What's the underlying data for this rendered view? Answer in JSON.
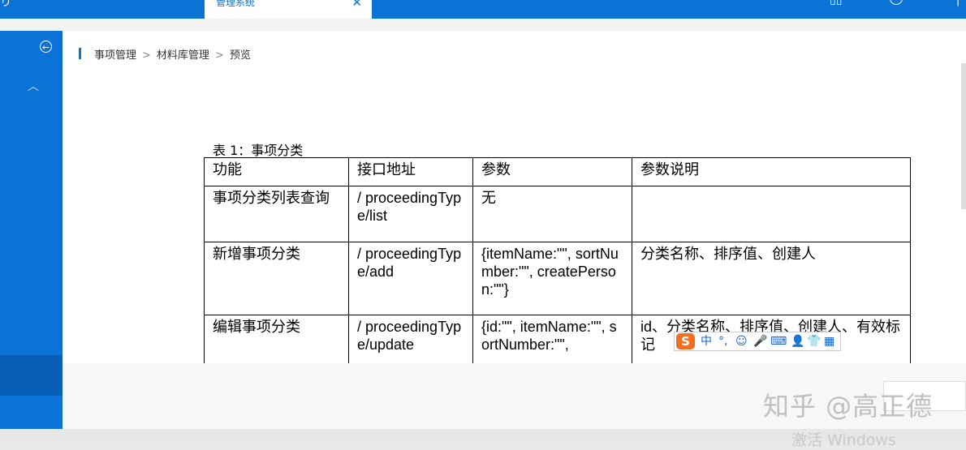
{
  "header": {
    "left_glyph": "り",
    "tab_title": "管理系统",
    "tab_close": "✕"
  },
  "breadcrumb": [
    "事项管理",
    "材料库管理",
    "预览"
  ],
  "breadcrumb_separator": ">",
  "table": {
    "caption": "表 1：事项分类",
    "columns": [
      "功能",
      "接口地址",
      "参数",
      "参数说明"
    ],
    "rows": [
      [
        "事项分类列表查询",
        "/ proceedingType/list",
        "无",
        ""
      ],
      [
        "新增事项分类",
        "/ proceedingType/add",
        "{itemName:\"\", sortNumber:\"\", createPerson:\"\"}",
        "分类名称、排序值、创建人"
      ],
      [
        "编辑事项分类",
        "/ proceedingType/update",
        "{id:\"\", itemName:\"\", sortNumber:\"\",",
        "id、分类名称、排序值、创建人、有效标记"
      ]
    ]
  },
  "ime_toolbar": {
    "logo": "S",
    "items": [
      "中",
      "°,",
      "☺",
      "🎤",
      "⌨",
      "👤",
      "👕",
      "▦"
    ]
  },
  "watermark": "知乎 @高正德",
  "activation_text": "激活 Windows",
  "colors": {
    "brand": "#0b72d6"
  }
}
